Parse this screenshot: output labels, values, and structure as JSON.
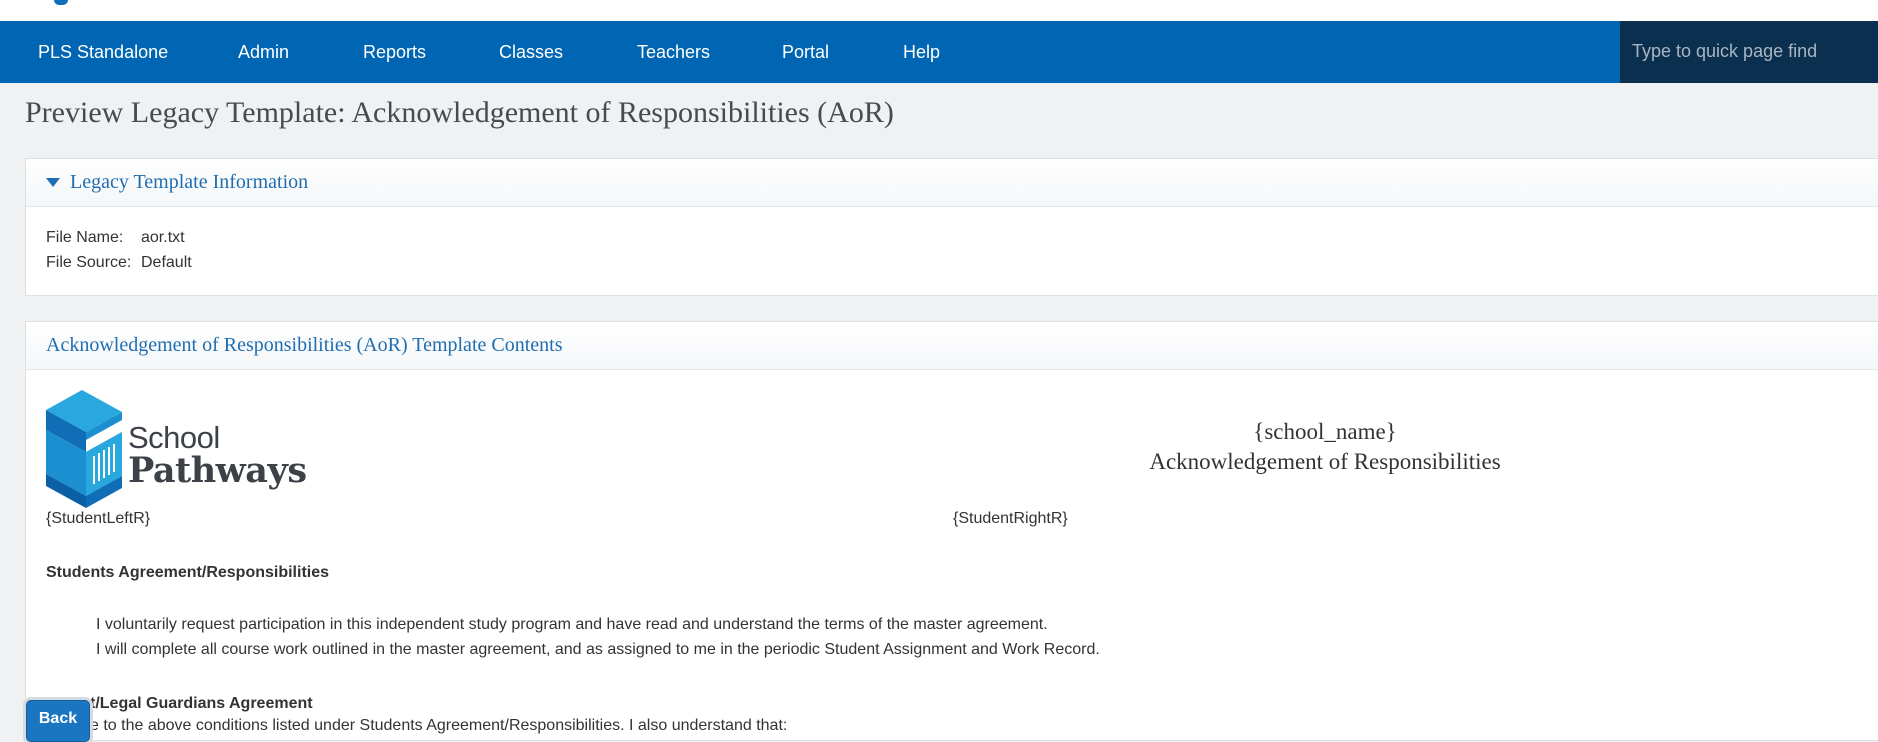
{
  "nav": {
    "items": [
      {
        "label": "PLS Standalone"
      },
      {
        "label": "Admin"
      },
      {
        "label": "Reports"
      },
      {
        "label": "Classes"
      },
      {
        "label": "Teachers"
      },
      {
        "label": "Portal"
      },
      {
        "label": "Help"
      }
    ],
    "quick_find_placeholder": "Type to quick page find"
  },
  "page": {
    "title": "Preview Legacy Template: Acknowledgement of Responsibilities (AoR)"
  },
  "info_panel": {
    "header": "Legacy Template Information",
    "file_name_label": "File Name:",
    "file_name_value": "aor.txt",
    "file_source_label": "File Source:",
    "file_source_value": "Default"
  },
  "contents_panel": {
    "header": "Acknowledgement of Responsibilities (AoR) Template Contents",
    "logo": {
      "word1": "School",
      "word2": "Pathways"
    },
    "school_name": "{school_name}",
    "subtitle": "Acknowledgement of Responsibilities",
    "student_left": "{StudentLeftR}",
    "student_right": "{StudentRightR}",
    "students_heading": "Students Agreement/Responsibilities",
    "students_lines": [
      "I voluntarily request participation in this independent study program and have read and understand the terms of the master agreement.",
      "I will complete all course work outlined in the master agreement, and as assigned to me in the periodic Student Assignment and Work Record."
    ],
    "guardians_heading_partial": "t/Legal Guardians Agreement",
    "guardians_line_partial": "e to the above conditions listed under Students Agreement/Responsibilities. I also understand that:"
  },
  "back_button": {
    "label": "Back"
  },
  "colors": {
    "nav_bg": "#0066b3",
    "quick_find_bg": "#0a2f4f",
    "link_blue": "#1f6db0",
    "page_bg": "#eff1f3"
  }
}
